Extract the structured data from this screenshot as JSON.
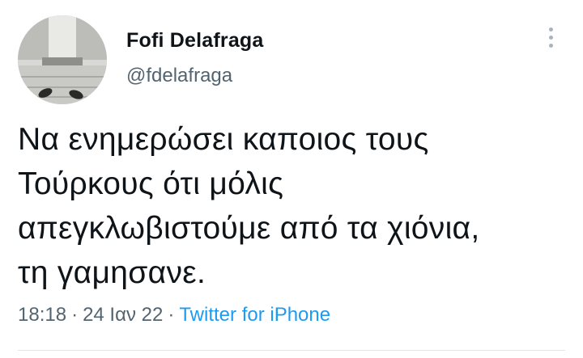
{
  "user": {
    "display_name": "Fofi Delafraga",
    "handle": "@fdelafraga"
  },
  "tweet": {
    "text": "Να ενημερώσει καποιος τους\nΤούρκους ότι μόλις\nαπεγκλωβιστούμε από τα χιόνια,\nτη γαμησανε."
  },
  "meta": {
    "time": "18:18",
    "separator": "·",
    "date": "24 Ιαν 22",
    "source": "Twitter for iPhone"
  },
  "icons": {
    "more": "more-vertical-icon"
  },
  "colors": {
    "text": "#0f1419",
    "secondary": "#536471",
    "link": "#1d9bf0"
  }
}
